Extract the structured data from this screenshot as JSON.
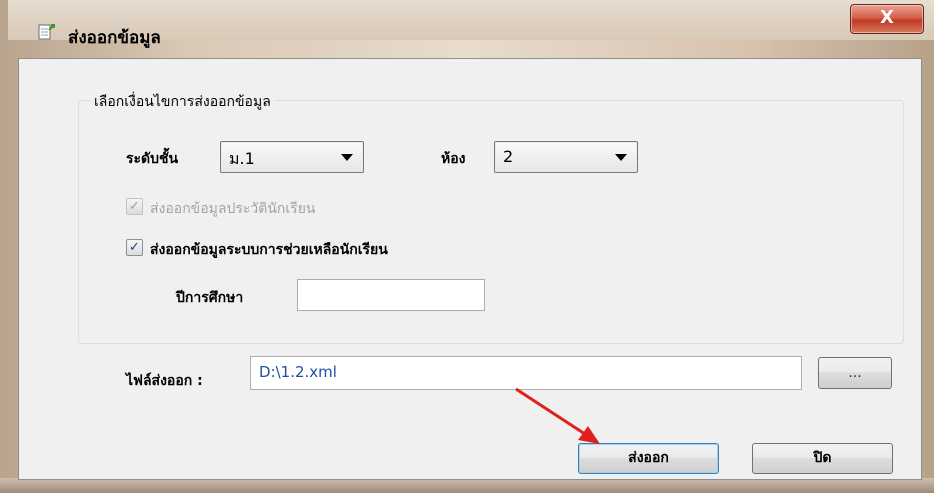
{
  "window": {
    "title": "ส่งออกข้อมูล",
    "close_label": "X"
  },
  "group": {
    "legend": "เลือกเงื่อนไขการส่งออกข้อมูล",
    "level_label": "ระดับชั้น",
    "level_value": "ม.1",
    "room_label": "ห้อง",
    "room_value": "2",
    "check_history_label": "ส่งออกข้อมูลประวัตินักเรียน",
    "check_history_mark": "✓",
    "check_support_label": "ส่งออกข้อมูลระบบการช่วยเหลือนักเรียน",
    "check_support_mark": "✓",
    "year_label": "ปีการศึกษา",
    "year_value": ""
  },
  "export": {
    "file_label": "ไฟล์ส่งออก :",
    "file_value": "D:\\1.2.xml",
    "browse_label": "...",
    "export_button": "ส่งออก",
    "close_button": "ปิด"
  },
  "colors": {
    "annotation_arrow": "#e0201b",
    "path_text": "#1f4fa3"
  }
}
